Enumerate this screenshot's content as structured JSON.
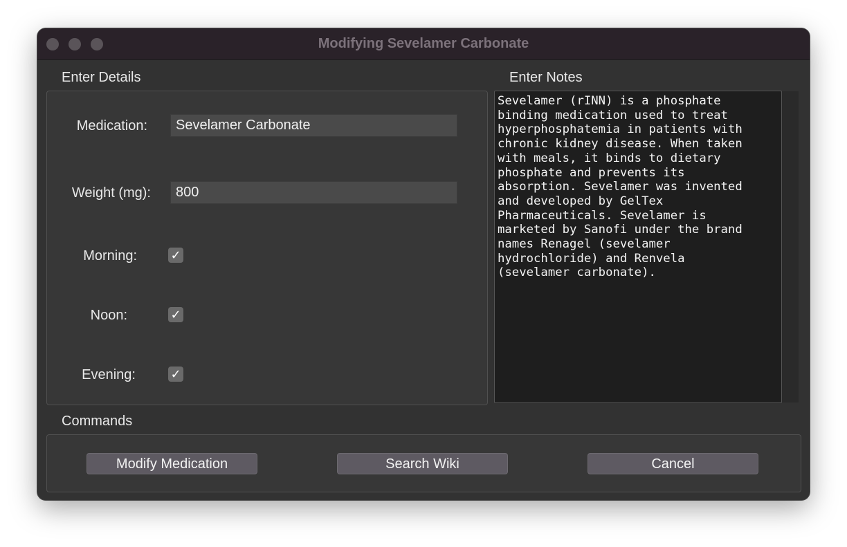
{
  "window": {
    "title": "Modifying Sevelamer Carbonate"
  },
  "details": {
    "section_label": "Enter Details",
    "medication_label": "Medication:",
    "medication_value": "Sevelamer Carbonate",
    "weight_label": "Weight (mg):",
    "weight_value": "800",
    "morning_label": "Morning:",
    "morning_checked": true,
    "noon_label": "Noon:",
    "noon_checked": true,
    "evening_label": "Evening:",
    "evening_checked": true,
    "check_glyph": "✓"
  },
  "notes": {
    "section_label": "Enter Notes",
    "text": "Sevelamer (rINN) is a phosphate\nbinding medication used to treat\nhyperphosphatemia in patients with\nchronic kidney disease. When taken\nwith meals, it binds to dietary\nphosphate and prevents its\nabsorption. Sevelamer was invented\nand developed by GelTex\nPharmaceuticals. Sevelamer is\nmarketed by Sanofi under the brand\nnames Renagel (sevelamer\nhydrochloride) and Renvela\n(sevelamer carbonate)."
  },
  "commands": {
    "section_label": "Commands",
    "modify_label": "Modify Medication",
    "search_label": "Search Wiki",
    "cancel_label": "Cancel"
  }
}
